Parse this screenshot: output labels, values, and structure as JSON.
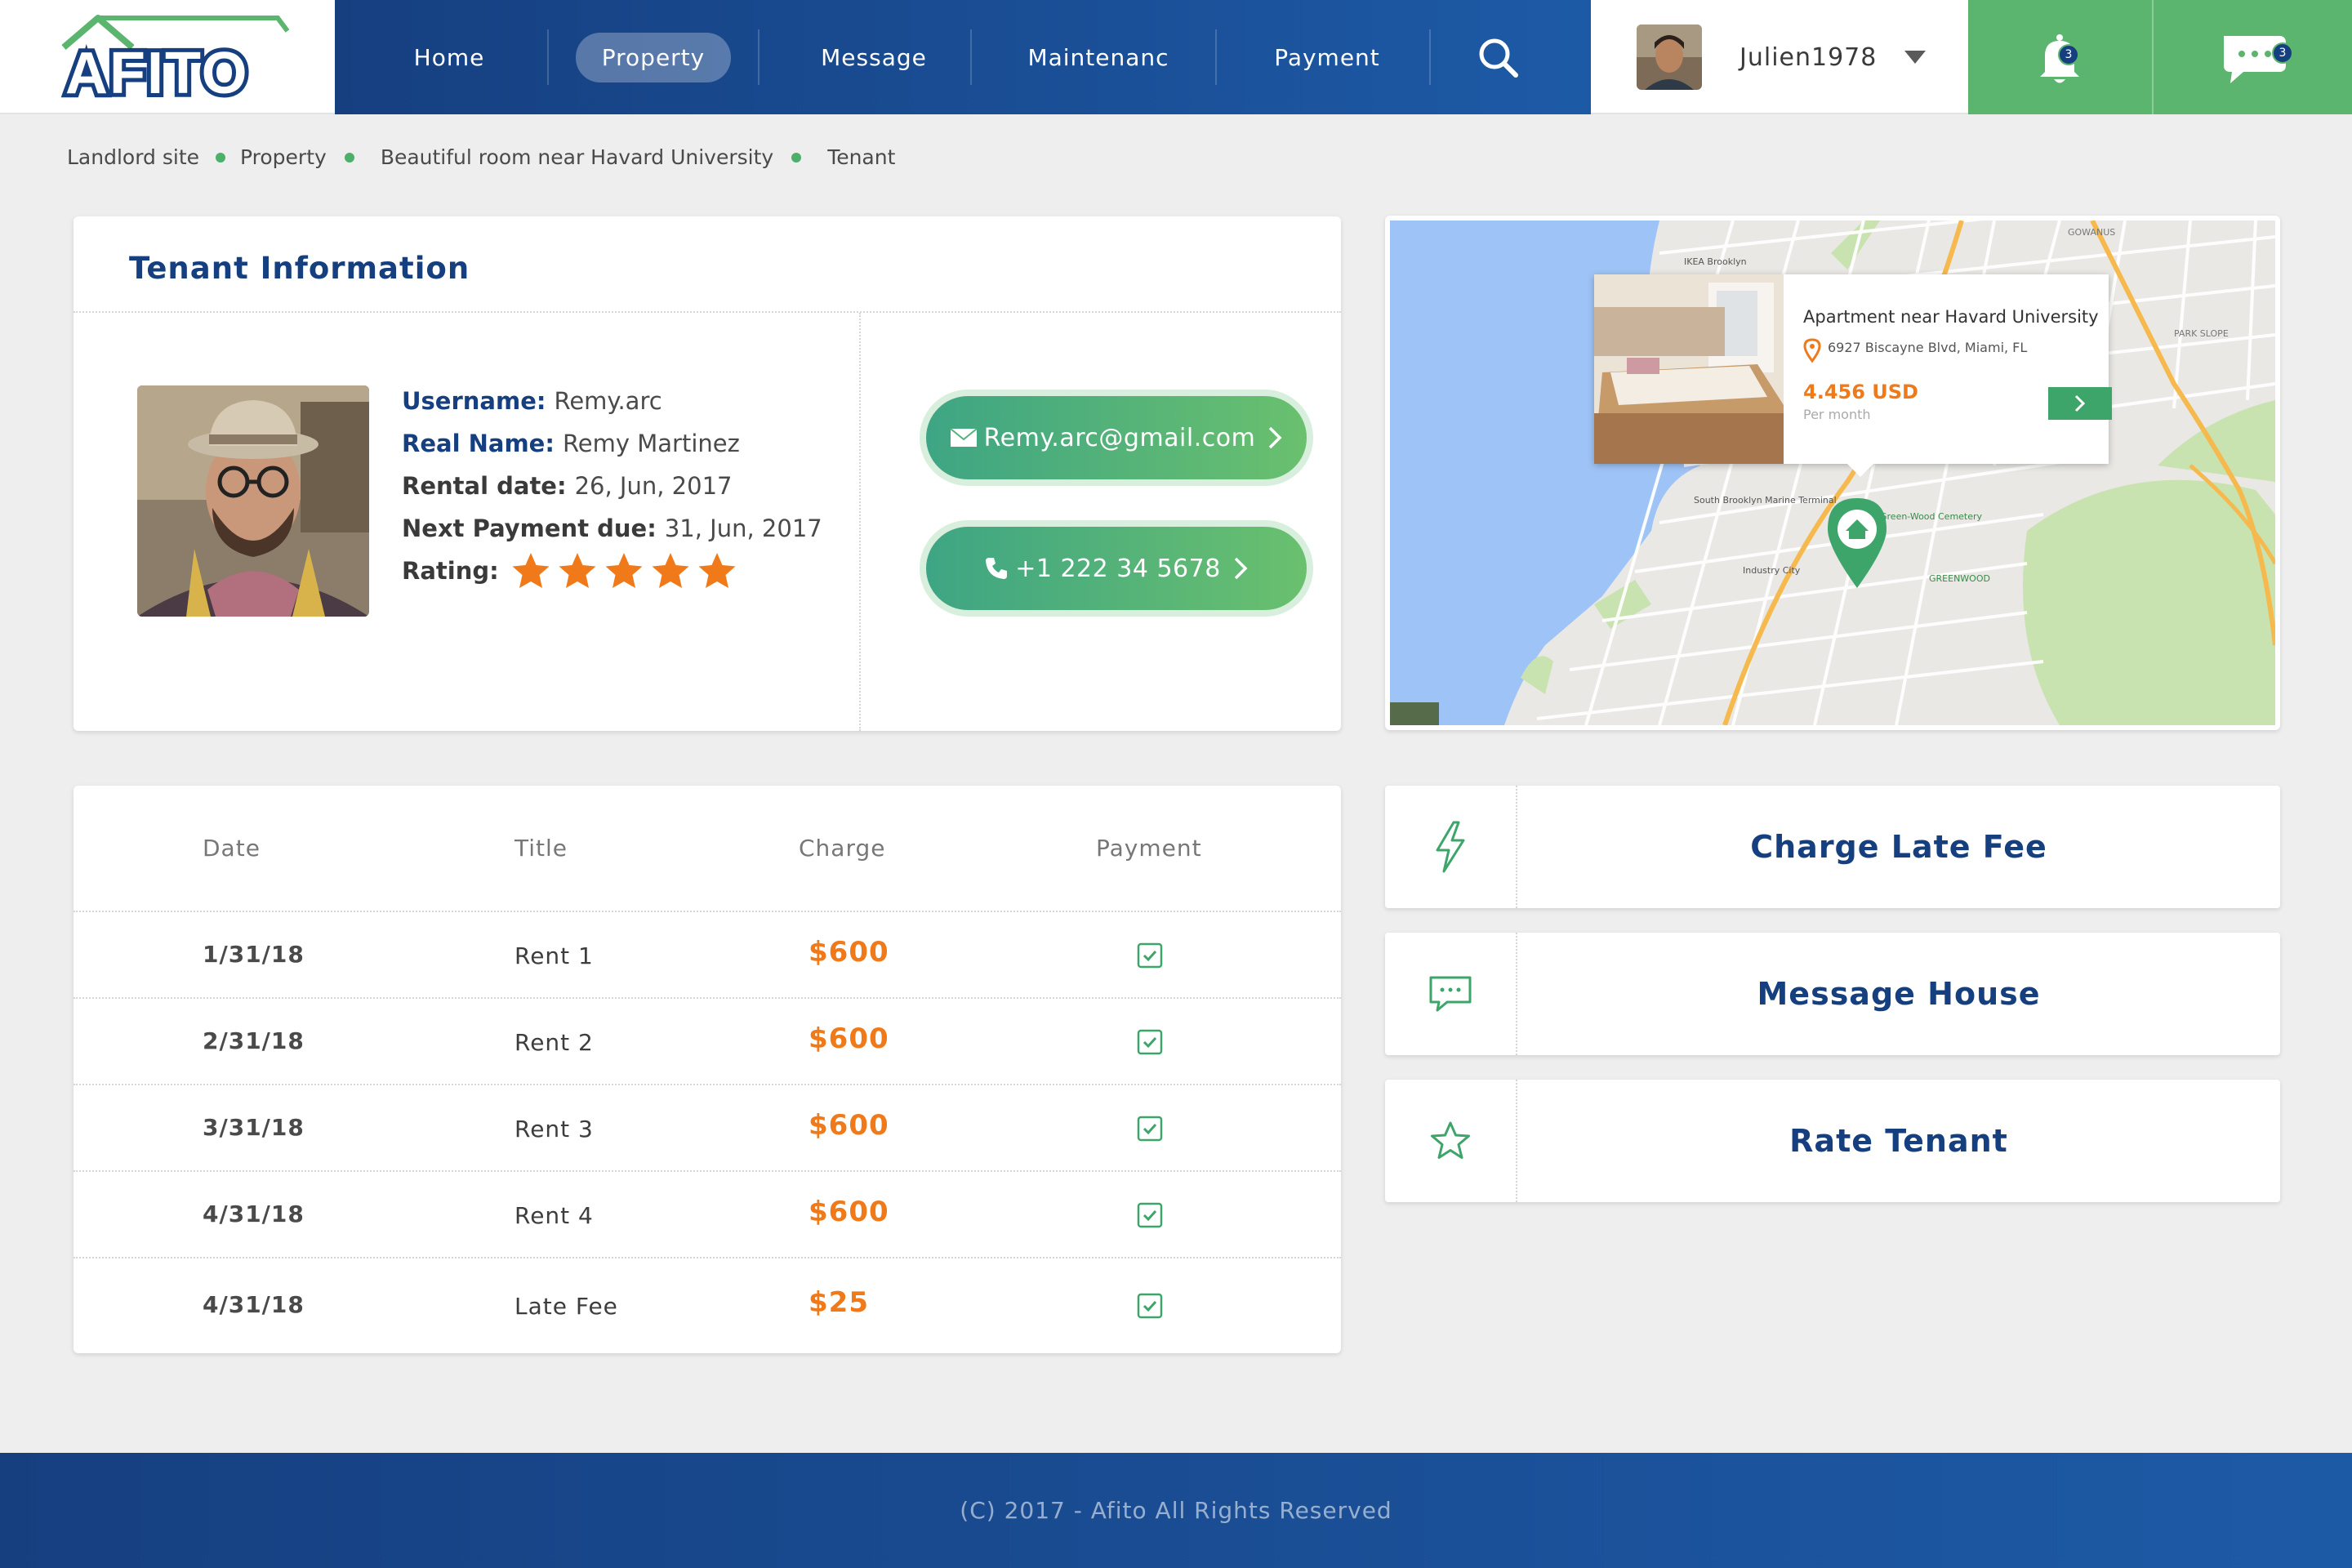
{
  "brand": {
    "logo_text": "AFITO"
  },
  "nav": {
    "items": [
      {
        "label": "Home"
      },
      {
        "label": "Property"
      },
      {
        "label": "Message"
      },
      {
        "label": "Maintenanc"
      },
      {
        "label": "Payment"
      }
    ],
    "active": "Property"
  },
  "user": {
    "name": "Julien1978"
  },
  "notifications": {
    "bell_count": "3",
    "chat_count": "3"
  },
  "breadcrumb": [
    "Landlord site",
    "Property",
    "Beautiful room near Havard University",
    "Tenant"
  ],
  "tenant": {
    "title": "Tenant Information",
    "username_label": "Username:",
    "username": "Remy.arc",
    "realname_label": "Real Name:",
    "realname": "Remy Martinez",
    "rental_label": "Rental date:",
    "rental_date": "26, Jun, 2017",
    "next_label": "Next Payment due:",
    "next_payment": "31, Jun, 2017",
    "rating_label": "Rating:",
    "rating": 5,
    "email": "Remy.arc@gmail.com",
    "phone": "+1 222 34 5678"
  },
  "map": {
    "listing_title": "Apartment near Havard University",
    "address": "6927 Biscayne Blvd, Miami, FL",
    "price": "4.456 USD",
    "per": "Per month",
    "labels": [
      "GOWANUS",
      "IKEA Brooklyn",
      "PARK SLOPE",
      "South Brooklyn Marine Terminal",
      "Green-Wood Cemetery",
      "Industry City",
      "GREENWOOD"
    ]
  },
  "payments": {
    "headers": [
      "Date",
      "Title",
      "Charge",
      "Payment"
    ],
    "rows": [
      {
        "date": "1/31/18",
        "title": "Rent 1",
        "charge": "$600",
        "paid": true
      },
      {
        "date": "2/31/18",
        "title": "Rent 2",
        "charge": "$600",
        "paid": true
      },
      {
        "date": "3/31/18",
        "title": "Rent 3",
        "charge": "$600",
        "paid": true
      },
      {
        "date": "4/31/18",
        "title": "Rent 4",
        "charge": "$600",
        "paid": true
      },
      {
        "date": "4/31/18",
        "title": "Late Fee",
        "charge": "$25",
        "paid": true
      }
    ]
  },
  "actions": [
    {
      "label": "Charge Late Fee",
      "icon": "lightning-icon"
    },
    {
      "label": "Message House",
      "icon": "message-icon"
    },
    {
      "label": "Rate Tenant",
      "icon": "star-icon"
    }
  ],
  "footer": {
    "copyright": "(C) 2017 - Afito All Rights Reserved"
  },
  "colors": {
    "navy": "#163f80",
    "green": "#5cb56e",
    "orange": "#f07a1a"
  }
}
